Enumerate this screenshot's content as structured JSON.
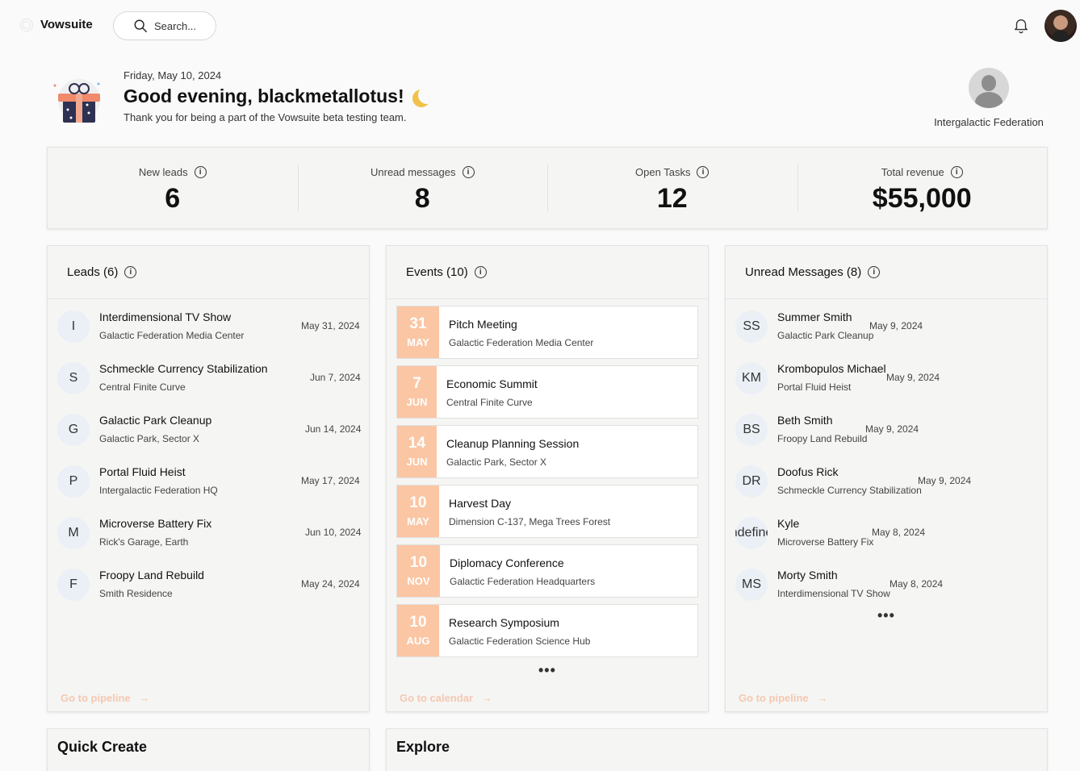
{
  "app": {
    "name": "Vowsuite"
  },
  "search": {
    "label": "Search..."
  },
  "greeting": {
    "date": "Friday, May 10, 2024",
    "title": "Good evening, blackmetallotus!",
    "subtitle": "Thank you for being a part of the Vowsuite beta testing team."
  },
  "organization": {
    "name": "Intergalactic Federation"
  },
  "stats": [
    {
      "label": "New leads",
      "value": "6"
    },
    {
      "label": "Unread messages",
      "value": "8"
    },
    {
      "label": "Open Tasks",
      "value": "12"
    },
    {
      "label": "Total revenue",
      "value": "$55,000"
    }
  ],
  "leads": {
    "title": "Leads (6)",
    "footer": "Go to pipeline",
    "items": [
      {
        "initial": "I",
        "title": "Interdimensional TV Show",
        "sub": "Galactic Federation Media Center",
        "date": "May 31, 2024"
      },
      {
        "initial": "S",
        "title": "Schmeckle Currency Stabilization",
        "sub": "Central Finite Curve",
        "date": "Jun 7, 2024"
      },
      {
        "initial": "G",
        "title": "Galactic Park Cleanup",
        "sub": "Galactic Park, Sector X",
        "date": "Jun 14, 2024"
      },
      {
        "initial": "P",
        "title": "Portal Fluid Heist",
        "sub": "Intergalactic Federation HQ",
        "date": "May 17, 2024"
      },
      {
        "initial": "M",
        "title": "Microverse Battery Fix",
        "sub": "Rick's Garage, Earth",
        "date": "Jun 10, 2024"
      },
      {
        "initial": "F",
        "title": "Froopy Land Rebuild",
        "sub": "Smith Residence",
        "date": "May 24, 2024"
      }
    ]
  },
  "events": {
    "title": "Events (10)",
    "footer": "Go to calendar",
    "more": "•••",
    "items": [
      {
        "day": "31",
        "month": "MAY",
        "title": "Pitch Meeting",
        "sub": "Galactic Federation Media Center"
      },
      {
        "day": "7",
        "month": "JUN",
        "title": "Economic Summit",
        "sub": "Central Finite Curve"
      },
      {
        "day": "14",
        "month": "JUN",
        "title": "Cleanup Planning Session",
        "sub": "Galactic Park, Sector X"
      },
      {
        "day": "10",
        "month": "MAY",
        "title": "Harvest Day",
        "sub": "Dimension C-137, Mega Trees Forest"
      },
      {
        "day": "10",
        "month": "NOV",
        "title": "Diplomacy Conference",
        "sub": "Galactic Federation Headquarters"
      },
      {
        "day": "10",
        "month": "AUG",
        "title": "Research Symposium",
        "sub": "Galactic Federation Science Hub"
      }
    ]
  },
  "messages": {
    "title": "Unread Messages (8)",
    "footer": "Go to pipeline",
    "more": "•••",
    "items": [
      {
        "initials": "SS",
        "name": "Summer Smith",
        "sub": "Galactic Park Cleanup",
        "date": "May 9, 2024"
      },
      {
        "initials": "KM",
        "name": "Krombopulos Michael",
        "sub": "Portal Fluid Heist",
        "date": "May 9, 2024"
      },
      {
        "initials": "BS",
        "name": "Beth Smith",
        "sub": "Froopy Land Rebuild",
        "date": "May 9, 2024"
      },
      {
        "initials": "DR",
        "name": "Doofus Rick",
        "sub": "Schmeckle Currency Stabilization",
        "date": "May 9, 2024"
      },
      {
        "initials": "undefined",
        "name": "Kyle",
        "sub": "Microverse Battery Fix",
        "date": "May 8, 2024"
      },
      {
        "initials": "MS",
        "name": "Morty Smith",
        "sub": "Interdimensional TV Show",
        "date": "May 8, 2024"
      }
    ]
  },
  "quick_create": {
    "title": "Quick Create"
  },
  "explore": {
    "title": "Explore"
  }
}
